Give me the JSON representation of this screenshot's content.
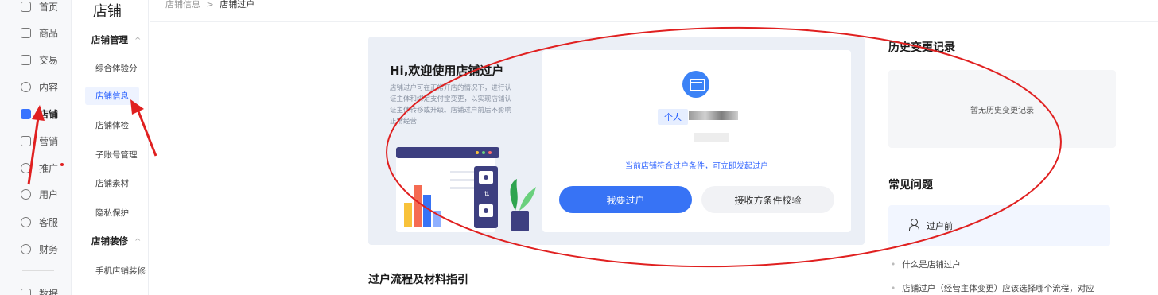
{
  "leftnav": {
    "items": [
      {
        "label": "首页",
        "icon": "home-icon"
      },
      {
        "label": "商品",
        "icon": "goods-icon"
      },
      {
        "label": "交易",
        "icon": "trade-icon"
      },
      {
        "label": "内容",
        "icon": "content-icon"
      },
      {
        "label": "店铺",
        "icon": "shop-icon"
      },
      {
        "label": "营销",
        "icon": "marketing-icon"
      },
      {
        "label": "推广",
        "icon": "promotion-icon"
      },
      {
        "label": "用户",
        "icon": "user-icon"
      },
      {
        "label": "客服",
        "icon": "service-icon"
      },
      {
        "label": "财务",
        "icon": "finance-icon"
      },
      {
        "label": "数据",
        "icon": "data-icon"
      }
    ],
    "active": "店铺"
  },
  "subnav": {
    "title": "店铺",
    "group1": "店铺管理",
    "items1": [
      "综合体验分",
      "店铺信息",
      "店铺体检",
      "子账号管理",
      "店铺素材",
      "隐私保护"
    ],
    "group2": "店铺装修",
    "items2": [
      "手机店铺装修"
    ],
    "active": "店铺信息"
  },
  "breadcrumb": {
    "parent": "店铺信息",
    "separator": ">",
    "current": "店铺过户"
  },
  "welcome": {
    "title": "Hi,欢迎使用店铺过户",
    "description": "店铺过户可在正常开店的情况下，进行认证主体和绑定支付宝变更，以实现店铺认证主体转移或升级。店铺过户前后不影响正常经营"
  },
  "shop": {
    "type_tag": "个人",
    "eligible_text": "当前店铺符合过户条件，可立即发起过户"
  },
  "buttons": {
    "transfer": "我要过户",
    "check": "接收方条件校验"
  },
  "section": {
    "process_title": "过户流程及材料指引"
  },
  "history": {
    "title": "历史变更记录",
    "empty": "暂无历史变更记录"
  },
  "faq": {
    "title": "常见问题",
    "category": "过户前",
    "questions": [
      "什么是店铺过户",
      "店铺过户（经营主体变更）应该选择哪个流程，对应"
    ]
  },
  "colors": {
    "accent": "#3773f5",
    "annotation": "#e02020"
  }
}
